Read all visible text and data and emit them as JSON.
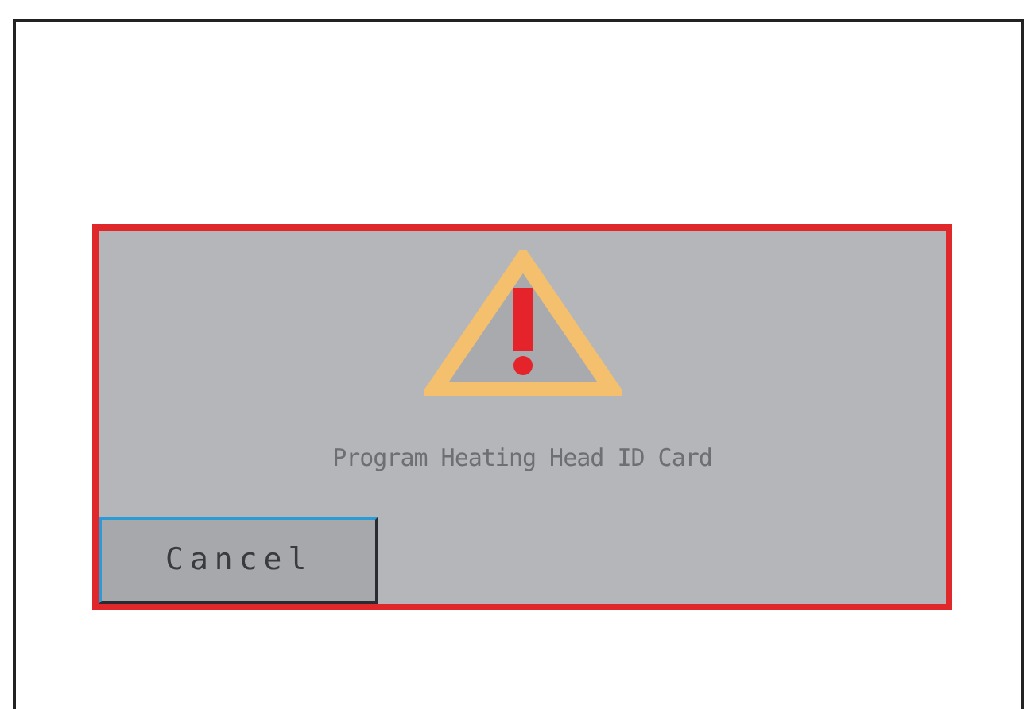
{
  "dialog": {
    "kind": "warning",
    "message": "Program Heating Head ID Card",
    "buttons": [
      {
        "label": "Cancel",
        "focused": true
      }
    ]
  }
}
